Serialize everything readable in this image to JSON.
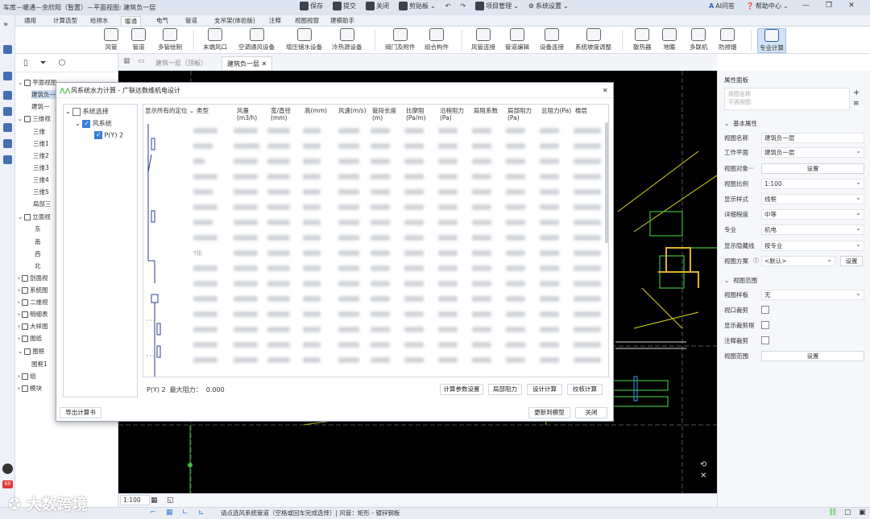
{
  "titlebar": {
    "title": "车库－暖通－余欣阳（暂置）－平面视图: 建筑负一层",
    "actions": [
      "保存",
      "提交",
      "关闭",
      "剪贴板",
      "项目管理",
      "系统设置"
    ],
    "ai_label": "AI问答",
    "help_label": "帮助中心"
  },
  "menu_tabs": [
    "通用",
    "计算选型",
    "给排水",
    "暖通",
    "电气",
    "管道",
    "支吊架(体验版)",
    "注释",
    "视图视窗",
    "建模助手"
  ],
  "menu_active": 3,
  "ribbon": [
    "风管",
    "管道",
    "多管绘制",
    "末端风口",
    "空调通风设备",
    "增压储水设备",
    "冷热源设备",
    "阀门及附件",
    "组合构件",
    "风管连接",
    "管道编辑",
    "设备连接",
    "系统坡度调整",
    "散热器",
    "地暖",
    "多联机",
    "防排烟",
    "专业计算"
  ],
  "browser": {
    "items": [
      "平面视图",
      "建筑负一",
      "建筑一",
      "三维视",
      "三维",
      "三维1",
      "三维2",
      "三维3",
      "三维4",
      "三维5",
      "局部三",
      "立面视",
      "东",
      "南",
      "西",
      "北",
      "剖面视",
      "系统图",
      "二维视",
      "明细表",
      "大样图",
      "图纸",
      "图框",
      "图框1",
      "组",
      "模块"
    ]
  },
  "doc_tabs": [
    "建筑一层（顶板）",
    "建筑负一层"
  ],
  "dialog": {
    "title": "风系统水力计算 - 广联达数维机电设计",
    "close": "✕",
    "tree": {
      "root": "系统选择",
      "group": "风系统",
      "item": "P(Y) 2"
    },
    "headers": [
      "显示所有的定位",
      "类型",
      "风量(m3/h)",
      "宽/直径(mm)",
      "高(mm)",
      "风速(m/s)",
      "管段长度(m)",
      "比摩阻(Pa/m)",
      "沿程阻力(Pa)",
      "局阻系数",
      "局部阻力(Pa)",
      "总阻力(Pa)",
      "楼层"
    ],
    "visible_type_cell": "T形",
    "summary": "P(Y) 2  最大阻力：  0.000",
    "buttons": [
      "计算参数设置",
      "局部阻力",
      "设计计算",
      "校核计算"
    ],
    "export_label": "导出计算书",
    "update_label": "更新到模型",
    "close_label": "关闭"
  },
  "properties": {
    "header": "属性面板",
    "view_name_label": "视图名称",
    "view_type_label": "平面视图",
    "section_basic": "基本属性",
    "rows": [
      {
        "label": "视图名称",
        "value": "建筑负一层",
        "type": "text"
      },
      {
        "label": "工作平面",
        "value": "建筑负一层",
        "type": "dropdown"
      },
      {
        "label": "视图对象···",
        "value": "设置",
        "type": "button"
      },
      {
        "label": "视图比例",
        "value": "1:100",
        "type": "dropdown"
      },
      {
        "label": "显示样式",
        "value": "线框",
        "type": "dropdown"
      },
      {
        "label": "详细程度",
        "value": "中等",
        "type": "dropdown"
      },
      {
        "label": "专业",
        "value": "机电",
        "type": "dropdown"
      },
      {
        "label": "显示隐藏线",
        "value": "按专业",
        "type": "dropdown"
      }
    ],
    "view_scheme_label": "视图方案",
    "view_scheme_value": "<默认>",
    "view_scheme_btn": "设置",
    "section_range": "视图范围",
    "template_label": "视图样板",
    "template_value": "无",
    "crop_label": "视口裁剪",
    "show_crop_label": "显示裁剪框",
    "annot_crop_label": "注释裁剪",
    "range_label": "视图范围",
    "range_btn": "设置"
  },
  "statusbar": {
    "scale": "1:100",
    "message": "请点选风系统管道（空格或回车完成选择）| 风管：矩形 - 镀锌钢板"
  },
  "watermark": "大数跨境",
  "badge_count": "60",
  "colors": {
    "accent": "#3a7fd6",
    "canvas": "#000000",
    "cad_green": "#3cbc3c",
    "cad_yellow": "#d9d51e"
  }
}
